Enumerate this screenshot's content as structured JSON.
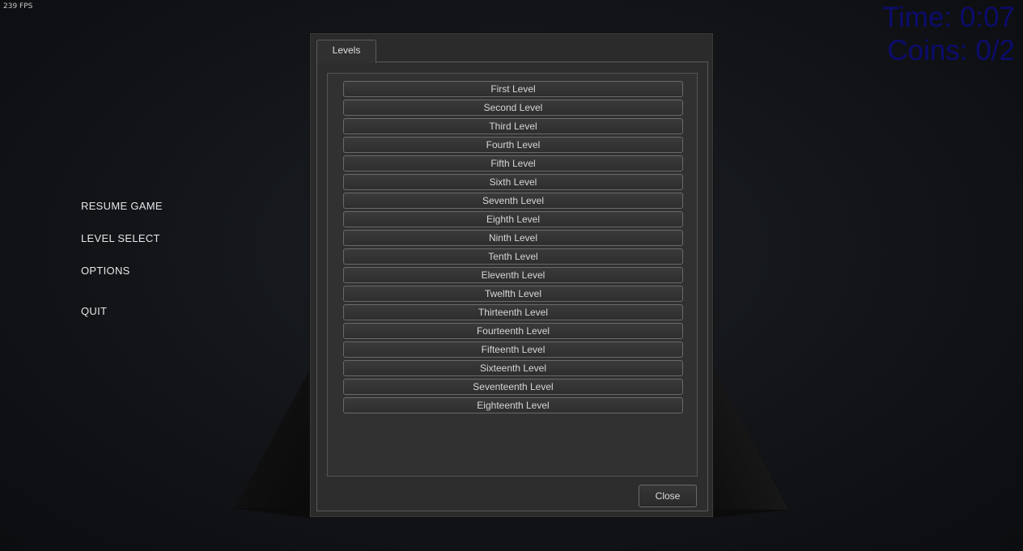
{
  "hud": {
    "fps": "239 FPS",
    "time": "Time: 0:07",
    "coins": "Coins: 0/2",
    "text_color": "#0c0c6e"
  },
  "pause_menu": {
    "items": [
      {
        "id": "resume",
        "label": "RESUME GAME"
      },
      {
        "id": "level-select",
        "label": "LEVEL SELECT"
      },
      {
        "id": "options",
        "label": "OPTIONS"
      },
      {
        "id": "quit",
        "label": "QUIT"
      }
    ]
  },
  "level_window": {
    "tab_label": "Levels",
    "levels": [
      "First Level",
      "Second Level",
      "Third Level",
      "Fourth Level",
      "Fifth Level",
      "Sixth Level",
      "Seventh Level",
      "Eighth Level",
      "Ninth Level",
      "Tenth Level",
      "Eleventh Level",
      "Twelfth Level",
      "Thirteenth Level",
      "Fourteenth Level",
      "Fifteenth Level",
      "Sixteenth Level",
      "Seventeenth Level",
      "Eighteenth Level"
    ],
    "close_label": "Close"
  }
}
